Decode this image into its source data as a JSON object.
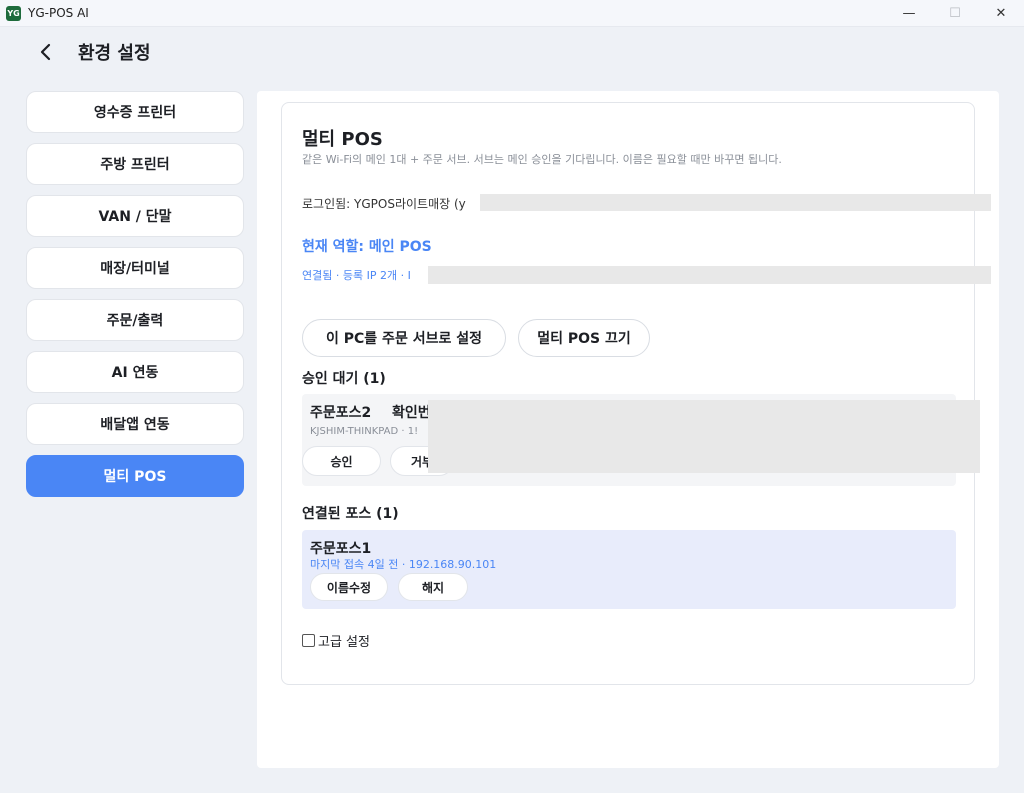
{
  "window": {
    "app_logo_text": "YG",
    "title": "YG-POS AI",
    "controls": {
      "minimize": "—",
      "maximize": "☐",
      "close": "✕"
    }
  },
  "header": {
    "title": "환경 설정"
  },
  "sidebar": {
    "items": [
      {
        "label": "영수증 프린터"
      },
      {
        "label": "주방 프린터"
      },
      {
        "label": "VAN / 단말"
      },
      {
        "label": "매장/터미널"
      },
      {
        "label": "주문/출력"
      },
      {
        "label": "AI 연동"
      },
      {
        "label": "배달앱 연동"
      },
      {
        "label": "멀티 POS"
      }
    ],
    "active_index": 7
  },
  "card": {
    "title": "멀티 POS",
    "description": "같은 Wi-Fi의 메인 1대 + 주문 서브. 서브는 메인 승인을 기다립니다. 이름은 필요할 때만 바꾸면 됩니다.",
    "login": "로그인됨: YGPOS라이트매장 (y",
    "role": "현재 역할: 메인 POS",
    "connection": "연결됨 · 등록 IP 2개 · I",
    "buttons": {
      "set_sub": "이 PC를 주문 서브로 설정",
      "disconnect": "멀티 POS 끄기"
    },
    "pending": {
      "title": "승인 대기 (1)",
      "item": {
        "name": "주문포스2",
        "badge": "확인번",
        "meta": "KJSHIM-THINKPAD · 1!",
        "approve": "승인",
        "reject": "거부"
      }
    },
    "connected": {
      "title": "연결된 포스 (1)",
      "item": {
        "name": "주문포스1",
        "meta": "마지막 접속 4일 전 · 192.168.90.101",
        "rename": "이름수정",
        "remove": "해지"
      }
    },
    "advanced": "고급 설정"
  },
  "colors": {
    "accent": "#4a86f5",
    "background": "#eef1f6",
    "connected_bg": "#e8ecfb",
    "pending_bg": "#f4f5f7"
  }
}
